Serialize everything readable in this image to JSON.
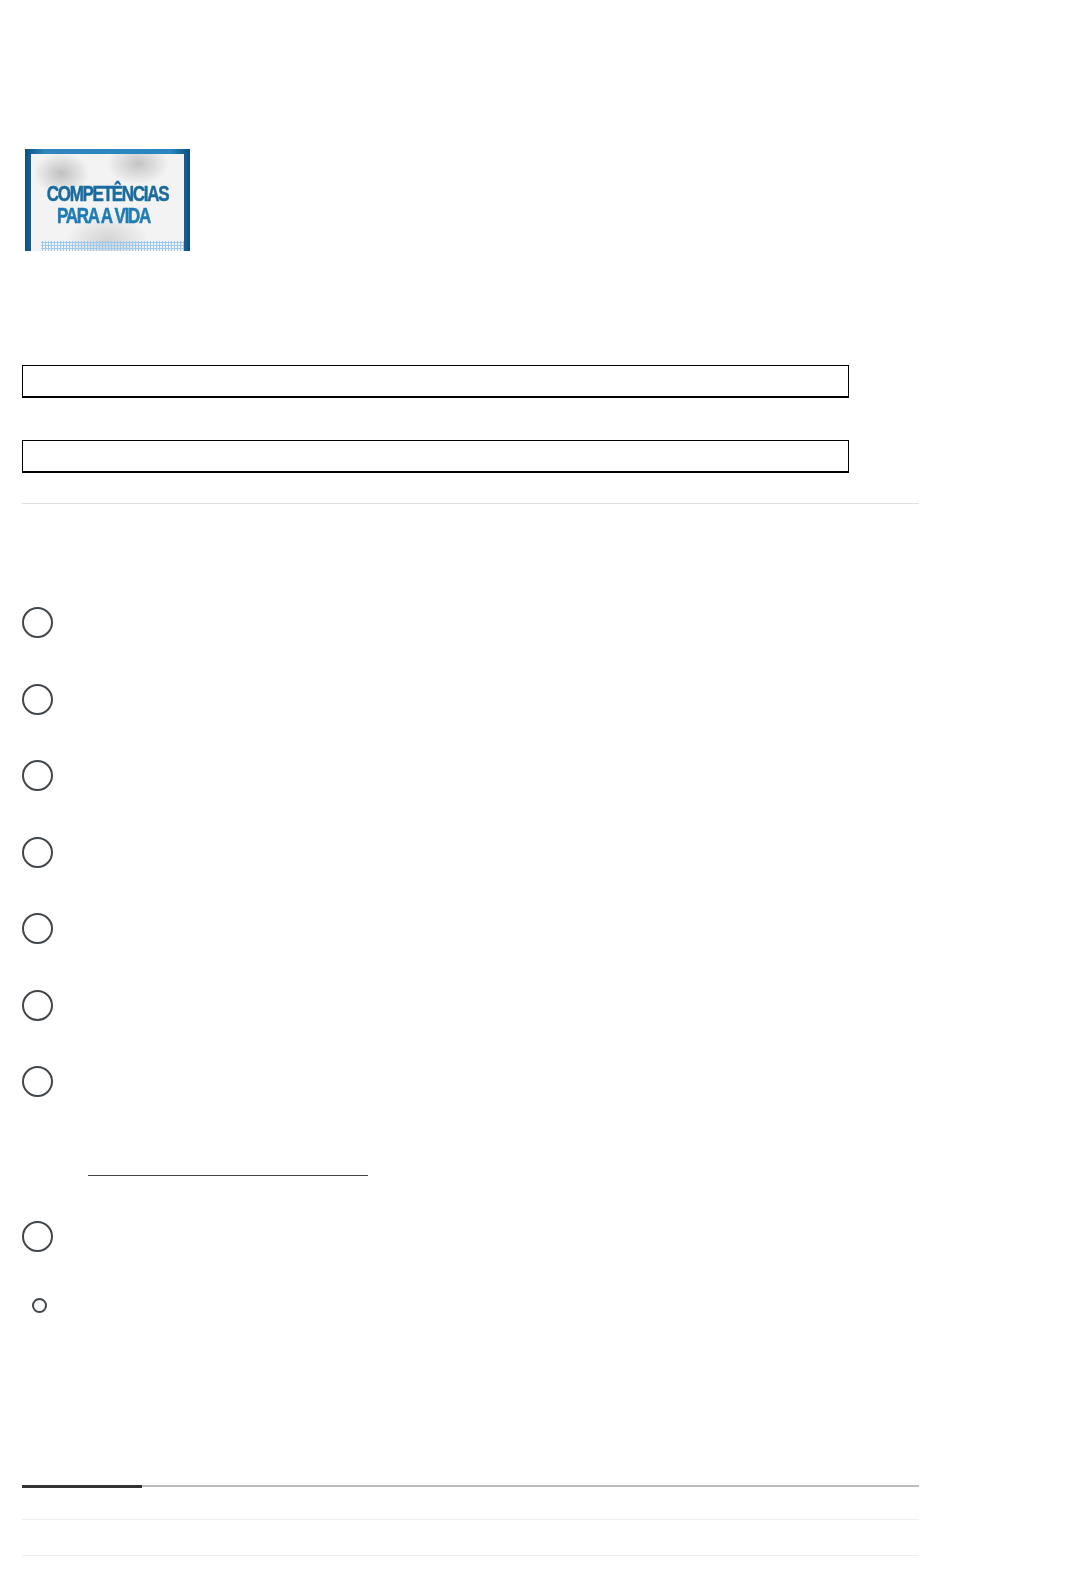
{
  "header_image": {
    "title": "COMPETÊNCIAS",
    "subtitle": "PARA A VIDA"
  },
  "text_fields": [
    {
      "kind": "short_answer"
    },
    {
      "kind": "short_answer"
    }
  ],
  "choices": [
    {
      "kind": "radio",
      "selected": false
    },
    {
      "kind": "radio",
      "selected": false
    },
    {
      "kind": "radio",
      "selected": false
    },
    {
      "kind": "radio",
      "selected": false
    },
    {
      "kind": "radio",
      "selected": false
    },
    {
      "kind": "radio",
      "selected": false
    },
    {
      "kind": "radio",
      "selected": false
    },
    {
      "kind": "fill_line"
    },
    {
      "kind": "radio",
      "selected": false
    },
    {
      "kind": "mini_radio",
      "selected": false
    }
  ],
  "progress": {
    "level": 0.134
  }
}
